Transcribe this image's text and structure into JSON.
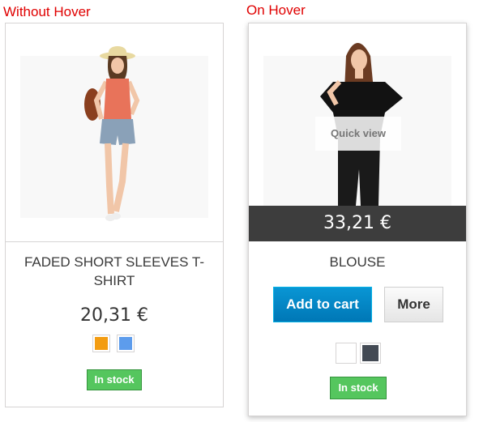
{
  "captions": {
    "without_hover": "Without Hover",
    "on_hover": "On Hover"
  },
  "cards": [
    {
      "name": "FADED SHORT SLEEVES T-SHIRT",
      "title_lines": [
        "FADED SHORT SLEEVES T-",
        "SHIRT"
      ],
      "price": "20,31 €",
      "swatches": [
        "#f39c11",
        "#5d9cec"
      ],
      "stock": "In stock",
      "state": "default"
    },
    {
      "name": "BLOUSE",
      "price": "33,21 €",
      "quick_view": "Quick view",
      "add_to_cart": "Add to cart",
      "more": "More",
      "swatches": [
        "#ffffff",
        "#434a54"
      ],
      "stock": "In stock",
      "state": "hover"
    }
  ],
  "colors": {
    "caption": "#e00000",
    "in_stock": "#55c65e",
    "add_to_cart": "#0a8ccf",
    "price_bar": "#3d3d3d"
  }
}
